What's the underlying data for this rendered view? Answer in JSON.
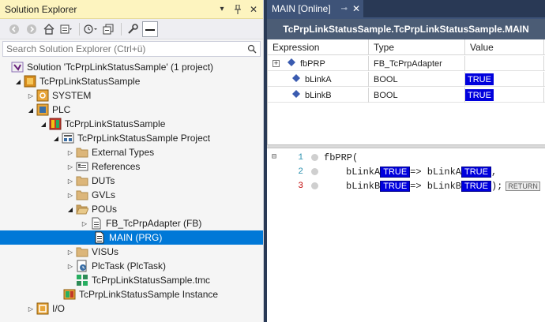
{
  "solution_explorer": {
    "title": "Solution Explorer",
    "search_placeholder": "Search Solution Explorer (Ctrl+ü)",
    "tree": [
      {
        "label": "Solution 'TcPrpLinkStatusSample' (1 project)",
        "icon": "solution-icon",
        "expander": ""
      },
      {
        "label": "TcPrpLinkStatusSample",
        "icon": "twincat-project-icon",
        "expander": "expanded"
      },
      {
        "label": "SYSTEM",
        "icon": "system-icon",
        "expander": "collapsed"
      },
      {
        "label": "PLC",
        "icon": "plc-icon",
        "expander": "expanded"
      },
      {
        "label": "TcPrpLinkStatusSample",
        "icon": "plc-project-icon",
        "expander": "expanded"
      },
      {
        "label": "TcPrpLinkStatusSample Project",
        "icon": "plc-project-node-icon",
        "expander": "expanded"
      },
      {
        "label": "External Types",
        "icon": "folder-icon",
        "expander": "collapsed"
      },
      {
        "label": "References",
        "icon": "references-icon",
        "expander": "collapsed"
      },
      {
        "label": "DUTs",
        "icon": "folder-icon",
        "expander": "collapsed"
      },
      {
        "label": "GVLs",
        "icon": "folder-icon",
        "expander": "collapsed"
      },
      {
        "label": "POUs",
        "icon": "folder-open-icon",
        "expander": "expanded"
      },
      {
        "label": "FB_TcPrpAdapter (FB)",
        "icon": "pou-file-icon",
        "expander": "collapsed"
      },
      {
        "label": "MAIN (PRG)",
        "icon": "pou-file-icon",
        "expander": "",
        "selected": true
      },
      {
        "label": "VISUs",
        "icon": "folder-icon",
        "expander": "collapsed"
      },
      {
        "label": "PlcTask (PlcTask)",
        "icon": "task-icon",
        "expander": "collapsed"
      },
      {
        "label": "TcPrpLinkStatusSample.tmc",
        "icon": "tmc-icon",
        "expander": ""
      },
      {
        "label": "TcPrpLinkStatusSample Instance",
        "icon": "instance-icon",
        "expander": ""
      },
      {
        "label": "I/O",
        "icon": "io-icon",
        "expander": "collapsed"
      }
    ]
  },
  "main_window": {
    "tab_label": "MAIN [Online]",
    "path": "TcPrpLinkStatusSample.TcPrpLinkStatusSample.MAIN",
    "watch": {
      "columns": [
        "Expression",
        "Type",
        "Value"
      ],
      "rows": [
        {
          "expression": "fbPRP",
          "type": "FB_TcPrpAdapter",
          "value": "",
          "expander": "plus"
        },
        {
          "expression": "bLinkA",
          "type": "BOOL",
          "value": "TRUE",
          "expander": ""
        },
        {
          "expression": "bLinkB",
          "type": "BOOL",
          "value": "TRUE",
          "expander": ""
        }
      ]
    },
    "code": {
      "line_numbers": [
        "1",
        "2",
        "3"
      ],
      "line1": "fbPRP(",
      "line2_a": "bLinkA",
      "line2_b": "=> bLinkA",
      "line2_c": ",",
      "line3_a": "bLinkB",
      "line3_b": "=> bLinkB",
      "line3_c": ");",
      "inline_value": "TRUE",
      "return_label": "RETURN"
    }
  },
  "colors": {
    "selection": "#0078d7",
    "online_value_bg": "#0000dd",
    "title_active": "#fdf4bf",
    "tab_active": "#3e5378"
  }
}
